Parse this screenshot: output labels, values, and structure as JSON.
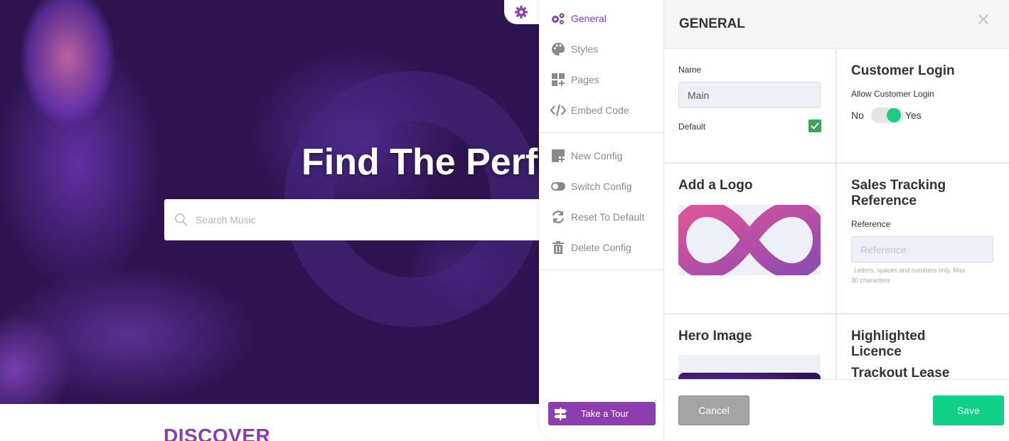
{
  "hero": {
    "title": "Find The Perfe",
    "search_placeholder": "Search Music"
  },
  "discover": {
    "label": "DISCOVER"
  },
  "sidebar": {
    "items": [
      {
        "label": "General",
        "icon": "gears-icon",
        "active": true
      },
      {
        "label": "Styles",
        "icon": "palette-icon"
      },
      {
        "label": "Pages",
        "icon": "pages-add-icon"
      },
      {
        "label": "Embed Code",
        "icon": "code-icon"
      }
    ],
    "config_items": [
      {
        "label": "New Config",
        "icon": "new-config-icon"
      },
      {
        "label": "Switch Config",
        "icon": "toggle-icon"
      },
      {
        "label": "Reset To Default",
        "icon": "refresh-icon"
      },
      {
        "label": "Delete Config",
        "icon": "trash-icon"
      }
    ],
    "tour_label": "Take a Tour"
  },
  "panel": {
    "title": "GENERAL",
    "general": {
      "name_label": "Name",
      "name_value": "Main",
      "default_label": "Default",
      "default_checked": true
    },
    "customer_login": {
      "title": "Customer Login",
      "allow_label": "Allow Customer Login",
      "no_label": "No",
      "yes_label": "Yes",
      "value": "Yes"
    },
    "logo": {
      "title": "Add a Logo"
    },
    "sales_tracking": {
      "title_line1": "Sales Tracking",
      "title_line2": "Reference",
      "reference_label": "Reference",
      "reference_placeholder": "Reference",
      "hint_line1": "Letters, spaces and numbers only. Max",
      "hint_line2": "30 characters"
    },
    "hero_image": {
      "title": "Hero Image"
    },
    "highlighted_licence": {
      "title_line1": "Highlighted",
      "title_line2": "Licence",
      "value": "Trackout Lease"
    }
  },
  "footer": {
    "cancel_label": "Cancel",
    "save_label": "Save"
  },
  "colors": {
    "accent": "#8e3db0",
    "save": "#10d088",
    "toggle_on": "#1fcc7f",
    "checkbox": "#3da55a",
    "hero_bg": "#2e1450"
  }
}
